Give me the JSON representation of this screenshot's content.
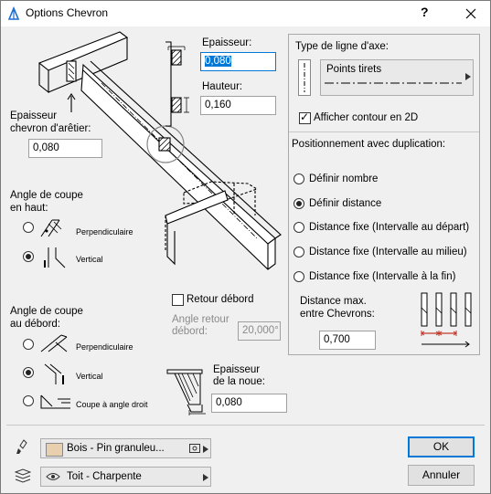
{
  "window": {
    "title": "Options Chevron",
    "help": "?",
    "close": "X"
  },
  "left": {
    "epaisseur_arretier_label": "Epaisseur\nchevron d'arêtier:",
    "epaisseur_arretier_value": "0,080",
    "angle_haut_label": "Angle de coupe\nen haut:",
    "angle_haut_options": [
      "Perpendiculaire",
      "Vertical"
    ],
    "angle_haut_selected": 1,
    "angle_debord_label": "Angle de coupe\nau débord:",
    "angle_debord_options": [
      "Perpendiculaire",
      "Vertical",
      "Coupe à angle droit"
    ],
    "angle_debord_selected": 1
  },
  "middle": {
    "epaisseur_label": "Epaisseur:",
    "epaisseur_value": "0,080",
    "hauteur_label": "Hauteur:",
    "hauteur_value": "0,160",
    "retour_debord_label": "Retour débord",
    "retour_debord_checked": false,
    "angle_retour_label": "Angle retour\ndébord:",
    "angle_retour_value": "20,000°",
    "epaisseur_noue_label": "Epaisseur\nde la noue:",
    "epaisseur_noue_value": "0,080"
  },
  "right": {
    "type_ligne_label": "Type de ligne d'axe:",
    "line_type_value": "Points tirets",
    "afficher_contour_label": "Afficher contour en 2D",
    "afficher_contour_checked": true,
    "positionnement_label": "Positionnement avec duplication:",
    "positionnement_options": [
      "Définir nombre",
      "Définir distance",
      "Distance fixe (Intervalle au départ)",
      "Distance fixe (Intervalle au milieu)",
      "Distance fixe (Intervalle à la fin)"
    ],
    "positionnement_selected": 1,
    "distance_max_label": "Distance max.\nentre Chevrons:",
    "distance_max_value": "0,700"
  },
  "footer": {
    "material_value": "Bois - Pin granuleu...",
    "layer_value": "Toit - Charpente",
    "ok_label": "OK",
    "cancel_label": "Annuler"
  },
  "colors": {
    "accent": "#0078d7",
    "material_swatch": "#e8cfae",
    "rafter_dim": "#c0392b"
  }
}
